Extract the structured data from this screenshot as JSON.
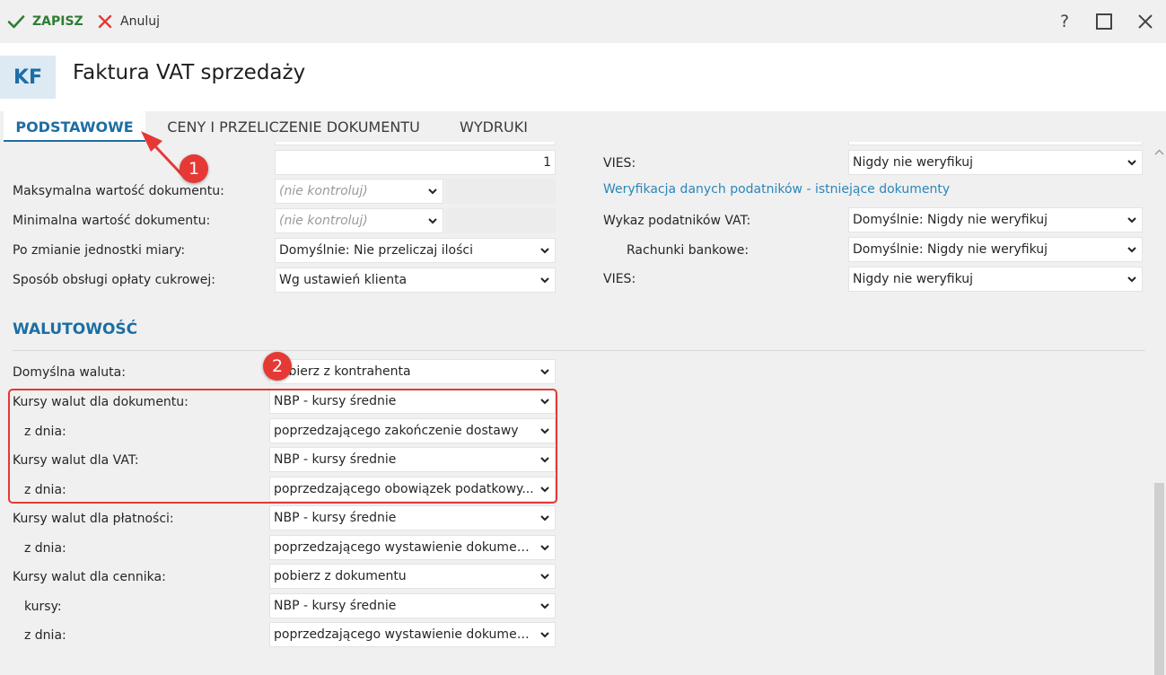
{
  "toolbar": {
    "save_label": "ZAPISZ",
    "cancel_label": "Anuluj",
    "help_label": "?",
    "maximize_label": "☐",
    "close_label": "✕"
  },
  "header": {
    "badge": "KF",
    "title": "Faktura VAT sprzedaży"
  },
  "tabs": [
    {
      "label": "PODSTAWOWE",
      "active": true
    },
    {
      "label": "CENY I PRZELICZENIE DOKUMENTU",
      "active": false
    },
    {
      "label": "WYDRUKI",
      "active": false
    }
  ],
  "left_fields": {
    "top_number": "1",
    "max_label": "Maksymalna wartość dokumentu:",
    "max_value": "(nie kontroluj)",
    "min_label": "Minimalna wartość dokumentu:",
    "min_value": "(nie kontroluj)",
    "unit_label": "Po zmianie jednostki miary:",
    "unit_value": "Domyślnie: Nie przeliczaj ilości",
    "sugar_label": "Sposób obsługi opłaty cukrowej:",
    "sugar_value": "Wg ustawień klienta"
  },
  "right_fields": {
    "vies1_label": "VIES:",
    "vies1_value": "Nigdy nie weryfikuj",
    "verify_link": "Weryfikacja danych podatników - istniejące dokumenty",
    "vat_list_label": "Wykaz podatników VAT:",
    "vat_list_value": "Domyślnie: Nigdy nie weryfikuj",
    "bank_label": "Rachunki bankowe:",
    "bank_value": "Domyślnie: Nigdy nie weryfikuj",
    "vies2_label": "VIES:",
    "vies2_value": "Nigdy nie weryfikuj"
  },
  "currency": {
    "section_title": "WALUTOWOŚĆ",
    "default_label": "Domyślna waluta:",
    "default_value": "Pobierz z kontrahenta",
    "doc_rates_label": "Kursy walut dla dokumentu:",
    "doc_rates_value": "NBP - kursy średnie",
    "doc_date_label": "z dnia:",
    "doc_date_value": "poprzedzającego zakończenie dostawy",
    "vat_rates_label": "Kursy walut dla VAT:",
    "vat_rates_value": "NBP - kursy średnie",
    "vat_date_label": "z dnia:",
    "vat_date_value": "poprzedzającego obowiązek podatkowy...",
    "pay_rates_label": "Kursy walut dla płatności:",
    "pay_rates_value": "NBP - kursy średnie",
    "pay_date_label": "z dnia:",
    "pay_date_value": "poprzedzającego wystawienie dokumentu",
    "price_rates_label": "Kursy walut dla cennika:",
    "price_rates_value": "pobierz z dokumentu",
    "price_kursy_label": "kursy:",
    "price_kursy_value": "NBP - kursy średnie",
    "price_date_label": "z dnia:",
    "price_date_value": "poprzedzającego wystawienie dokumentu"
  },
  "annotations": {
    "badge1": "1",
    "badge2": "2",
    "color": "#e53935"
  },
  "colors": {
    "accent": "#1c6ea4",
    "save_green": "#2e7d32",
    "cancel_red": "#e53935",
    "link": "#2a86b9"
  }
}
